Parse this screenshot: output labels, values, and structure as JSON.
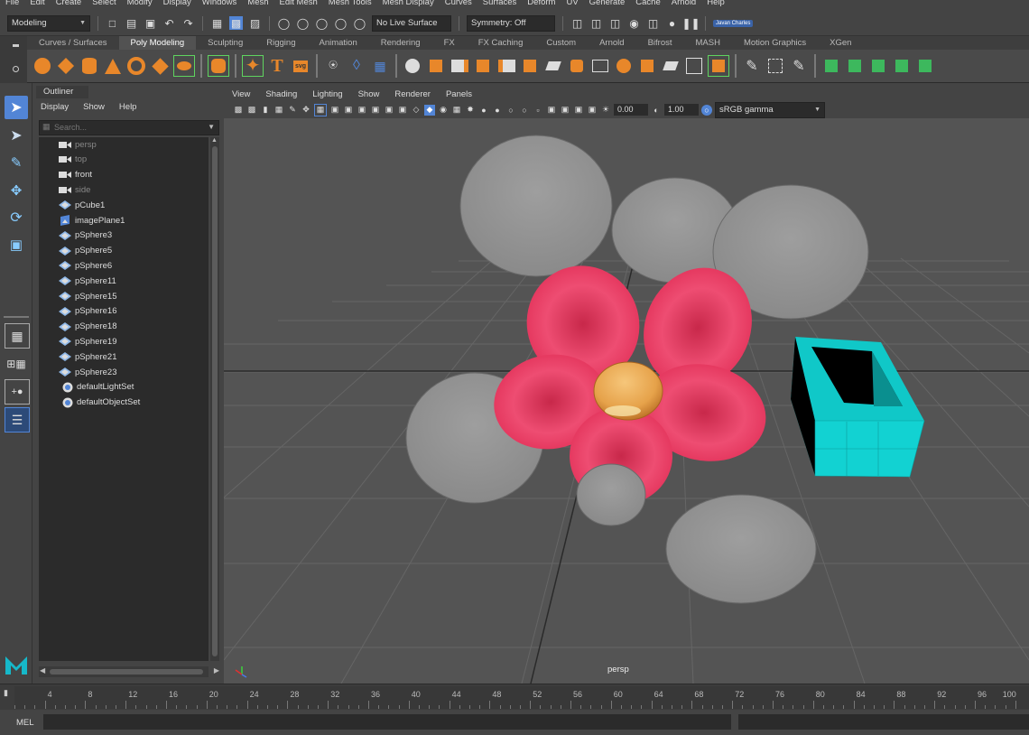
{
  "menubar": [
    "File",
    "Edit",
    "Create",
    "Select",
    "Modify",
    "Display",
    "Windows",
    "Mesh",
    "Edit Mesh",
    "Mesh Tools",
    "Mesh Display",
    "Curves",
    "Surfaces",
    "Deform",
    "UV",
    "Generate",
    "Cache",
    "Arnold",
    "Help"
  ],
  "status": {
    "workspace": "Modeling",
    "live_surface": "No Live Surface",
    "symmetry": "Symmetry: Off",
    "user": "Javan Charles"
  },
  "shelf_tabs": [
    "Curves / Surfaces",
    "Poly Modeling",
    "Sculpting",
    "Rigging",
    "Animation",
    "Rendering",
    "FX",
    "FX Caching",
    "Custom",
    "Arnold",
    "Bifrost",
    "MASH",
    "Motion Graphics",
    "XGen"
  ],
  "shelf_active": "Poly Modeling",
  "shelf_text_icon": "T",
  "shelf_svg_icon": "svg",
  "outliner": {
    "title": "Outliner",
    "menu": [
      "Display",
      "Show",
      "Help"
    ],
    "search_placeholder": "Search...",
    "items": [
      {
        "label": "persp",
        "icon": "camera-icon",
        "dim": true
      },
      {
        "label": "top",
        "icon": "camera-icon",
        "dim": true
      },
      {
        "label": "front",
        "icon": "camera-icon",
        "dim": false
      },
      {
        "label": "side",
        "icon": "camera-icon",
        "dim": true
      },
      {
        "label": "pCube1",
        "icon": "mesh-icon",
        "dim": false
      },
      {
        "label": "imagePlane1",
        "icon": "image-plane-icon",
        "dim": false
      },
      {
        "label": "pSphere3",
        "icon": "mesh-icon",
        "dim": false
      },
      {
        "label": "pSphere5",
        "icon": "mesh-icon",
        "dim": false
      },
      {
        "label": "pSphere6",
        "icon": "mesh-icon",
        "dim": false
      },
      {
        "label": "pSphere11",
        "icon": "mesh-icon",
        "dim": false
      },
      {
        "label": "pSphere15",
        "icon": "mesh-icon",
        "dim": false
      },
      {
        "label": "pSphere16",
        "icon": "mesh-icon",
        "dim": false
      },
      {
        "label": "pSphere18",
        "icon": "mesh-icon",
        "dim": false
      },
      {
        "label": "pSphere19",
        "icon": "mesh-icon",
        "dim": false
      },
      {
        "label": "pSphere21",
        "icon": "mesh-icon",
        "dim": false
      },
      {
        "label": "pSphere23",
        "icon": "mesh-icon",
        "dim": false
      },
      {
        "label": "defaultLightSet",
        "icon": "set-icon",
        "dim": false
      },
      {
        "label": "defaultObjectSet",
        "icon": "set-icon",
        "dim": false
      }
    ]
  },
  "panel_menu": [
    "View",
    "Shading",
    "Lighting",
    "Show",
    "Renderer",
    "Panels"
  ],
  "panel_toolbar": {
    "exposure": "0.00",
    "gamma": "1.00",
    "color_space": "sRGB gamma"
  },
  "viewport": {
    "camera_label": "persp"
  },
  "timeline": {
    "ticks": [
      "4",
      "8",
      "12",
      "16",
      "20",
      "24",
      "28",
      "32",
      "36",
      "40",
      "44",
      "48",
      "52",
      "56",
      "60",
      "64",
      "68",
      "72",
      "76",
      "80",
      "84",
      "88",
      "92",
      "96",
      "100"
    ]
  },
  "mel": {
    "label": "MEL"
  },
  "colors": {
    "accent": "#5285d6",
    "cube": "#10c8c8",
    "petal": "#e8375e",
    "center": "#e8a84a",
    "logo": "#16b8c9"
  }
}
